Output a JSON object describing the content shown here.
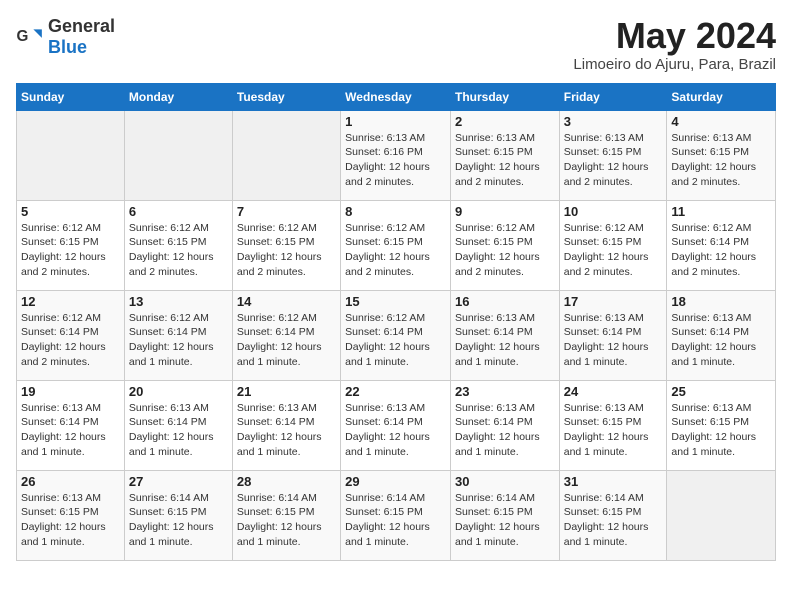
{
  "header": {
    "logo_general": "General",
    "logo_blue": "Blue",
    "month_title": "May 2024",
    "location": "Limoeiro do Ajuru, Para, Brazil"
  },
  "days_of_week": [
    "Sunday",
    "Monday",
    "Tuesday",
    "Wednesday",
    "Thursday",
    "Friday",
    "Saturday"
  ],
  "weeks": [
    [
      {
        "day": "",
        "info": ""
      },
      {
        "day": "",
        "info": ""
      },
      {
        "day": "",
        "info": ""
      },
      {
        "day": "1",
        "info": "Sunrise: 6:13 AM\nSunset: 6:16 PM\nDaylight: 12 hours and 2 minutes."
      },
      {
        "day": "2",
        "info": "Sunrise: 6:13 AM\nSunset: 6:15 PM\nDaylight: 12 hours and 2 minutes."
      },
      {
        "day": "3",
        "info": "Sunrise: 6:13 AM\nSunset: 6:15 PM\nDaylight: 12 hours and 2 minutes."
      },
      {
        "day": "4",
        "info": "Sunrise: 6:13 AM\nSunset: 6:15 PM\nDaylight: 12 hours and 2 minutes."
      }
    ],
    [
      {
        "day": "5",
        "info": "Sunrise: 6:12 AM\nSunset: 6:15 PM\nDaylight: 12 hours and 2 minutes."
      },
      {
        "day": "6",
        "info": "Sunrise: 6:12 AM\nSunset: 6:15 PM\nDaylight: 12 hours and 2 minutes."
      },
      {
        "day": "7",
        "info": "Sunrise: 6:12 AM\nSunset: 6:15 PM\nDaylight: 12 hours and 2 minutes."
      },
      {
        "day": "8",
        "info": "Sunrise: 6:12 AM\nSunset: 6:15 PM\nDaylight: 12 hours and 2 minutes."
      },
      {
        "day": "9",
        "info": "Sunrise: 6:12 AM\nSunset: 6:15 PM\nDaylight: 12 hours and 2 minutes."
      },
      {
        "day": "10",
        "info": "Sunrise: 6:12 AM\nSunset: 6:15 PM\nDaylight: 12 hours and 2 minutes."
      },
      {
        "day": "11",
        "info": "Sunrise: 6:12 AM\nSunset: 6:14 PM\nDaylight: 12 hours and 2 minutes."
      }
    ],
    [
      {
        "day": "12",
        "info": "Sunrise: 6:12 AM\nSunset: 6:14 PM\nDaylight: 12 hours and 2 minutes."
      },
      {
        "day": "13",
        "info": "Sunrise: 6:12 AM\nSunset: 6:14 PM\nDaylight: 12 hours and 1 minute."
      },
      {
        "day": "14",
        "info": "Sunrise: 6:12 AM\nSunset: 6:14 PM\nDaylight: 12 hours and 1 minute."
      },
      {
        "day": "15",
        "info": "Sunrise: 6:12 AM\nSunset: 6:14 PM\nDaylight: 12 hours and 1 minute."
      },
      {
        "day": "16",
        "info": "Sunrise: 6:13 AM\nSunset: 6:14 PM\nDaylight: 12 hours and 1 minute."
      },
      {
        "day": "17",
        "info": "Sunrise: 6:13 AM\nSunset: 6:14 PM\nDaylight: 12 hours and 1 minute."
      },
      {
        "day": "18",
        "info": "Sunrise: 6:13 AM\nSunset: 6:14 PM\nDaylight: 12 hours and 1 minute."
      }
    ],
    [
      {
        "day": "19",
        "info": "Sunrise: 6:13 AM\nSunset: 6:14 PM\nDaylight: 12 hours and 1 minute."
      },
      {
        "day": "20",
        "info": "Sunrise: 6:13 AM\nSunset: 6:14 PM\nDaylight: 12 hours and 1 minute."
      },
      {
        "day": "21",
        "info": "Sunrise: 6:13 AM\nSunset: 6:14 PM\nDaylight: 12 hours and 1 minute."
      },
      {
        "day": "22",
        "info": "Sunrise: 6:13 AM\nSunset: 6:14 PM\nDaylight: 12 hours and 1 minute."
      },
      {
        "day": "23",
        "info": "Sunrise: 6:13 AM\nSunset: 6:14 PM\nDaylight: 12 hours and 1 minute."
      },
      {
        "day": "24",
        "info": "Sunrise: 6:13 AM\nSunset: 6:15 PM\nDaylight: 12 hours and 1 minute."
      },
      {
        "day": "25",
        "info": "Sunrise: 6:13 AM\nSunset: 6:15 PM\nDaylight: 12 hours and 1 minute."
      }
    ],
    [
      {
        "day": "26",
        "info": "Sunrise: 6:13 AM\nSunset: 6:15 PM\nDaylight: 12 hours and 1 minute."
      },
      {
        "day": "27",
        "info": "Sunrise: 6:14 AM\nSunset: 6:15 PM\nDaylight: 12 hours and 1 minute."
      },
      {
        "day": "28",
        "info": "Sunrise: 6:14 AM\nSunset: 6:15 PM\nDaylight: 12 hours and 1 minute."
      },
      {
        "day": "29",
        "info": "Sunrise: 6:14 AM\nSunset: 6:15 PM\nDaylight: 12 hours and 1 minute."
      },
      {
        "day": "30",
        "info": "Sunrise: 6:14 AM\nSunset: 6:15 PM\nDaylight: 12 hours and 1 minute."
      },
      {
        "day": "31",
        "info": "Sunrise: 6:14 AM\nSunset: 6:15 PM\nDaylight: 12 hours and 1 minute."
      },
      {
        "day": "",
        "info": ""
      }
    ]
  ]
}
